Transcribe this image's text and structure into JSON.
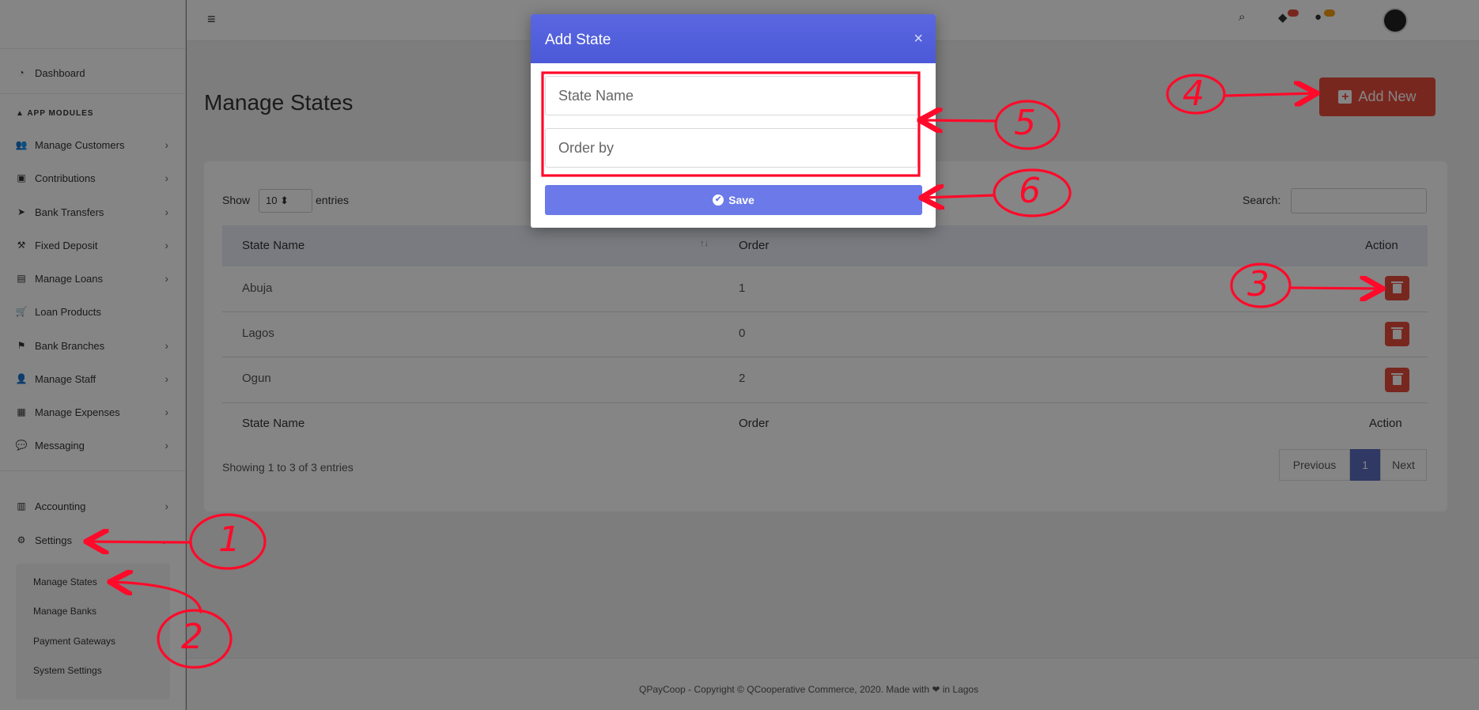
{
  "sidebar": {
    "dashboard": "Dashboard",
    "section_title": "APP MODULES",
    "items": [
      {
        "label": "Manage Customers",
        "icon": "users-icon"
      },
      {
        "label": "Contributions",
        "icon": "money-icon"
      },
      {
        "label": "Bank Transfers",
        "icon": "send-icon"
      },
      {
        "label": "Fixed Deposit",
        "icon": "gavel-icon"
      },
      {
        "label": "Manage Loans",
        "icon": "loan-icon"
      },
      {
        "label": "Loan Products",
        "icon": "cart-icon"
      },
      {
        "label": "Bank Branches",
        "icon": "flag-icon"
      },
      {
        "label": "Manage Staff",
        "icon": "user-icon"
      },
      {
        "label": "Manage Expenses",
        "icon": "calculator-icon"
      },
      {
        "label": "Messaging",
        "icon": "chat-icon"
      }
    ],
    "accounting": "Accounting",
    "settings": "Settings",
    "settings_sub": [
      "Manage States",
      "Manage Banks",
      "Payment Gateways",
      "System Settings"
    ]
  },
  "topbar": {
    "notifications_badge": "5",
    "messages_badge": "2"
  },
  "page": {
    "title": "Manage States",
    "add_new_label": "Add New"
  },
  "table": {
    "show_label": "Show",
    "page_length": "10",
    "entries_label": "entries",
    "search_label": "Search:",
    "columns": [
      "State Name",
      "Order",
      "Action"
    ],
    "rows": [
      {
        "state": "Abuja",
        "order": "1"
      },
      {
        "state": "Lagos",
        "order": "0"
      },
      {
        "state": "Ogun",
        "order": "2"
      }
    ],
    "info": "Showing 1 to 3 of 3 entries",
    "prev_label": "Previous",
    "page_number": "1",
    "next_label": "Next"
  },
  "modal": {
    "title": "Add State",
    "close_symbol": "×",
    "state_name_placeholder": "State Name",
    "order_placeholder": "Order by",
    "save_label": "Save"
  },
  "footer": {
    "text": "QPayCoop - Copyright © QCooperative Commerce, 2020. Made with ❤ in Lagos"
  },
  "annotations": {
    "labels": [
      "1",
      "2",
      "3",
      "4",
      "5",
      "6"
    ],
    "color": "#ff0a2a"
  },
  "colors": {
    "accent": "#5a67e0",
    "danger": "#e74c3c",
    "page_accent": "#5c6bc0"
  }
}
